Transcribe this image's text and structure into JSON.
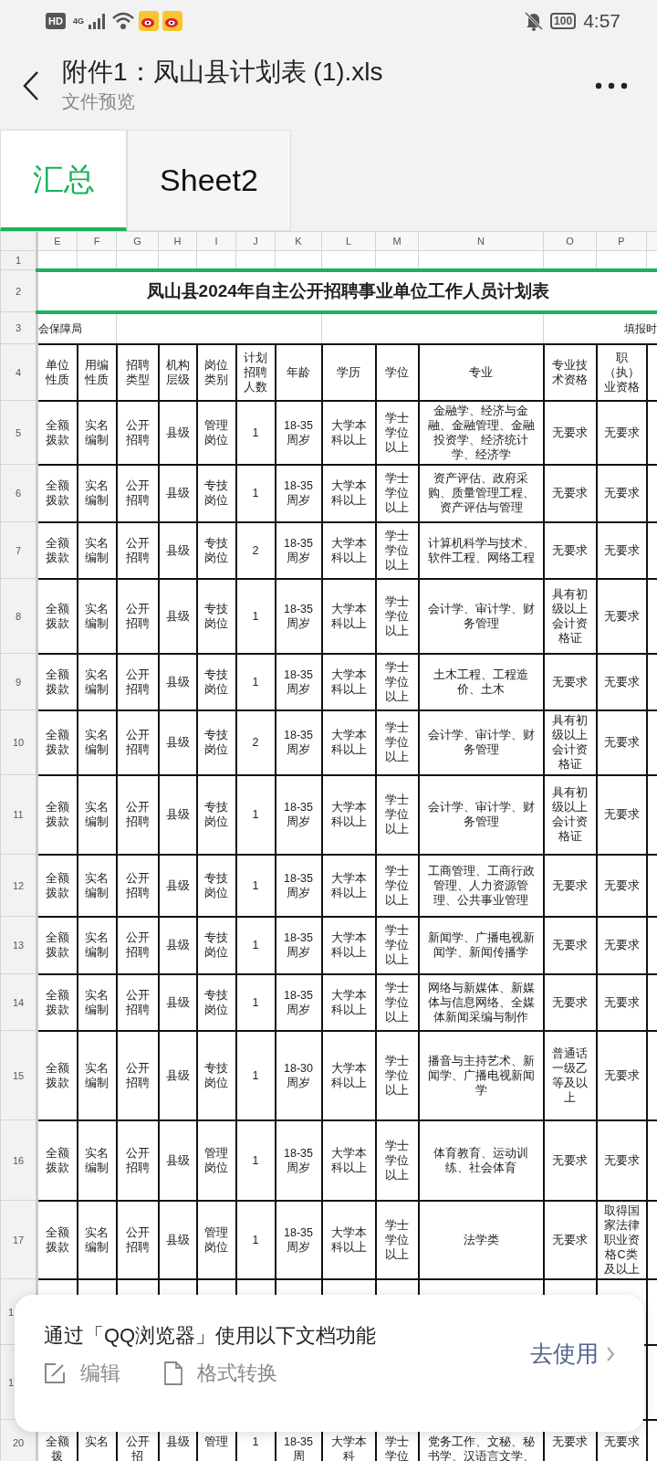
{
  "status_bar": {
    "hd": "HD",
    "network": "4G",
    "battery": "100",
    "time": "4:57"
  },
  "header": {
    "title": "附件1：凤山县计划表 (1).xls",
    "subtitle": "文件预览"
  },
  "sheet_tabs": [
    {
      "label": "汇总",
      "selected": true
    },
    {
      "label": "Sheet2",
      "selected": false
    }
  ],
  "columns": [
    "E",
    "F",
    "G",
    "H",
    "I",
    "J",
    "K",
    "L",
    "M",
    "N",
    "O",
    "P"
  ],
  "row1": {
    "row": "1"
  },
  "title_row": {
    "row": "2",
    "text": "凤山县2024年自主公开招聘事业单位工作人员计划表"
  },
  "row3": {
    "row": "3",
    "left": "会保障局",
    "right": "填报时"
  },
  "header_row": {
    "row": "4",
    "cells": [
      "单位性质",
      "用编性质",
      "招聘类型",
      "机构层级",
      "岗位类别",
      "计划招聘人数",
      "年龄",
      "学历",
      "学位",
      "专业",
      "专业技术资格",
      "职（执）业资格"
    ]
  },
  "rows": [
    {
      "row": "5",
      "cells": [
        "全额拨款",
        "实名编制",
        "公开招聘",
        "县级",
        "管理岗位",
        "1",
        "18-35周岁",
        "大学本科以上",
        "学士学位以上",
        "金融学、经济与金融、金融管理、金融投资学、经济统计学、经济学",
        "无要求",
        "无要求"
      ]
    },
    {
      "row": "6",
      "cells": [
        "全额拨款",
        "实名编制",
        "公开招聘",
        "县级",
        "专技岗位",
        "1",
        "18-35周岁",
        "大学本科以上",
        "学士学位以上",
        "资产评估、政府采购、质量管理工程、资产评估与管理",
        "无要求",
        "无要求"
      ]
    },
    {
      "row": "7",
      "cells": [
        "全额拨款",
        "实名编制",
        "公开招聘",
        "县级",
        "专技岗位",
        "2",
        "18-35周岁",
        "大学本科以上",
        "学士学位以上",
        "计算机科学与技术、软件工程、网络工程",
        "无要求",
        "无要求"
      ]
    },
    {
      "row": "8",
      "cells": [
        "全额拨款",
        "实名编制",
        "公开招聘",
        "县级",
        "专技岗位",
        "1",
        "18-35周岁",
        "大学本科以上",
        "学士学位以上",
        "会计学、审计学、财务管理",
        "具有初级以上会计资格证",
        "无要求"
      ]
    },
    {
      "row": "9",
      "cells": [
        "全额拨款",
        "实名编制",
        "公开招聘",
        "县级",
        "专技岗位",
        "1",
        "18-35周岁",
        "大学本科以上",
        "学士学位以上",
        "土木工程、工程造价、土木",
        "无要求",
        "无要求"
      ]
    },
    {
      "row": "10",
      "cells": [
        "全额拨款",
        "实名编制",
        "公开招聘",
        "县级",
        "专技岗位",
        "2",
        "18-35周岁",
        "大学本科以上",
        "学士学位以上",
        "会计学、审计学、财务管理",
        "具有初级以上会计资格证",
        "无要求"
      ]
    },
    {
      "row": "11",
      "cells": [
        "全额拨款",
        "实名编制",
        "公开招聘",
        "县级",
        "专技岗位",
        "1",
        "18-35周岁",
        "大学本科以上",
        "学士学位以上",
        "会计学、审计学、财务管理",
        "具有初级以上会计资格证",
        "无要求"
      ]
    },
    {
      "row": "12",
      "cells": [
        "全额拨款",
        "实名编制",
        "公开招聘",
        "县级",
        "专技岗位",
        "1",
        "18-35周岁",
        "大学本科以上",
        "学士学位以上",
        "工商管理、工商行政管理、人力资源管理、公共事业管理",
        "无要求",
        "无要求"
      ]
    },
    {
      "row": "13",
      "cells": [
        "全额拨款",
        "实名编制",
        "公开招聘",
        "县级",
        "专技岗位",
        "1",
        "18-35周岁",
        "大学本科以上",
        "学士学位以上",
        "新闻学、广播电视新闻学、新闻传播学",
        "无要求",
        "无要求"
      ]
    },
    {
      "row": "14",
      "cells": [
        "全额拨款",
        "实名编制",
        "公开招聘",
        "县级",
        "专技岗位",
        "1",
        "18-35周岁",
        "大学本科以上",
        "学士学位以上",
        "网络与新媒体、新媒体与信息网络、全媒体新闻采编与制作",
        "无要求",
        "无要求"
      ]
    },
    {
      "row": "15",
      "cells": [
        "全额拨款",
        "实名编制",
        "公开招聘",
        "县级",
        "专技岗位",
        "1",
        "18-30周岁",
        "大学本科以上",
        "学士学位以上",
        "播音与主持艺术、新闻学、广播电视新闻学",
        "普通话一级乙等及以上",
        "无要求"
      ]
    },
    {
      "row": "16",
      "cells": [
        "全额拨款",
        "实名编制",
        "公开招聘",
        "县级",
        "管理岗位",
        "1",
        "18-35周岁",
        "大学本科以上",
        "学士学位以上",
        "体育教育、运动训练、社会体育",
        "无要求",
        "无要求"
      ]
    },
    {
      "row": "17",
      "cells": [
        "全额拨款",
        "实名编制",
        "公开招聘",
        "县级",
        "管理岗位",
        "1",
        "18-35周岁",
        "大学本科以上",
        "学士学位以上",
        "法学类",
        "无要求",
        "取得国家法律职业资格C类及以上"
      ]
    },
    {
      "row": "1"
    },
    {
      "row": "1"
    },
    {
      "row": "20",
      "cells": [
        "全额拨",
        "实名",
        "公开招",
        "县级",
        "管理",
        "1",
        "18-35周",
        "大学本科",
        "学士学位",
        "党务工作、文秘、秘书学、汉语言文学、",
        "无要求",
        "无要求"
      ]
    }
  ],
  "popup": {
    "text": "通过「QQ浏览器」使用以下文档功能",
    "actions": [
      {
        "kind": "edit",
        "label": "编辑"
      },
      {
        "kind": "convert",
        "label": "格式转换"
      }
    ],
    "button": "去使用"
  }
}
